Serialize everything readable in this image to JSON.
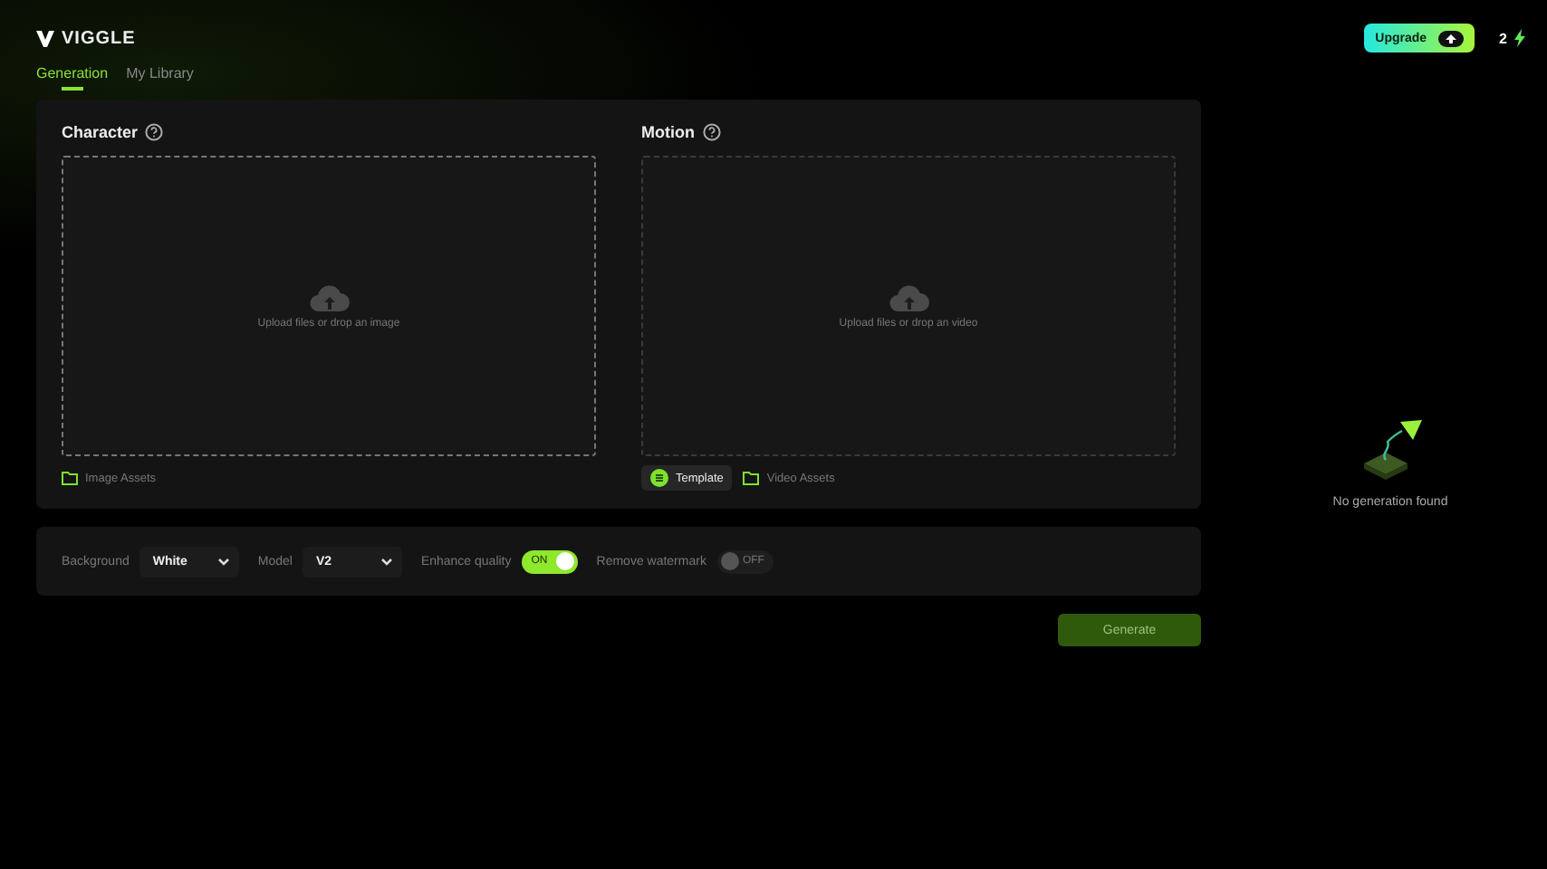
{
  "header": {
    "logo": "VIGGLE",
    "upgrade": "Upgrade",
    "credits": "2"
  },
  "tabs": [
    {
      "label": "Generation",
      "selected": true
    },
    {
      "label": "My Library",
      "selected": false
    }
  ],
  "character": {
    "title": "Character",
    "upload_hint": "Upload files or drop an image",
    "sources": [
      {
        "label": "Image Assets",
        "selected": false
      }
    ]
  },
  "motion": {
    "title": "Motion",
    "upload_hint": "Upload files or drop an video",
    "sources": [
      {
        "label": "Template",
        "selected": true
      },
      {
        "label": "Video Assets",
        "selected": false
      }
    ]
  },
  "options": [
    {
      "kind": "select",
      "label": "Background",
      "value": "White"
    },
    {
      "kind": "select",
      "label": "Model",
      "value": "V2"
    },
    {
      "kind": "toggle",
      "label": "Enhance quality",
      "on": true,
      "state_text": "ON"
    },
    {
      "kind": "toggle",
      "label": "Remove watermark",
      "on": false,
      "state_text": "OFF"
    }
  ],
  "generate": {
    "label": "Generate",
    "disabled": true
  },
  "empty_state": {
    "message": "No generation found"
  }
}
